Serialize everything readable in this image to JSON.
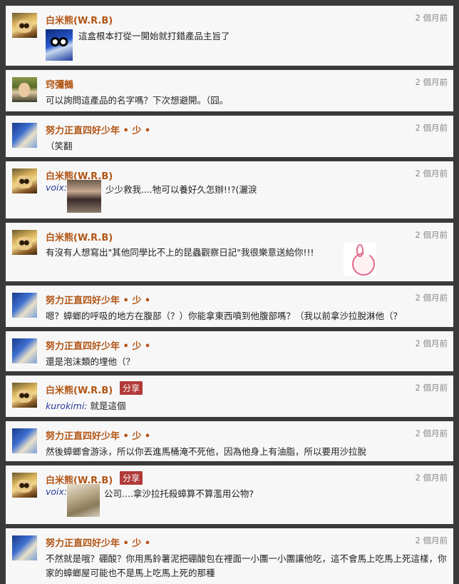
{
  "comments": [
    {
      "author": "白米熊(W.R.B)",
      "time": "2 個月前",
      "text": "這盒根本打從一開始就打錯產品主旨了"
    },
    {
      "author": "窍彌鵺",
      "time": "2 個月前",
      "text": "可以詢問這產品的名字嗎？下次想避開。（囧。"
    },
    {
      "author": "努力正直四好少年 • 少 •",
      "time": "2 個月前",
      "text": "（笑翻"
    },
    {
      "author": "白米熊(W.R.B)",
      "time": "2 個月前",
      "user": "voix:",
      "text": "少少救我....牠可以養好久怎辦!!?(灑淚"
    },
    {
      "author": "白米熊(W.R.B)",
      "time": "2 個月前",
      "text": "有沒有人想寫出\"其他同學比不上的昆蟲觀察日記\"我很樂意送給你!!!"
    },
    {
      "author": "努力正直四好少年 • 少 •",
      "time": "2 個月前",
      "text": "嗯？蟑螂的呼吸的地方在腹部（？）你能拿東西噴到他腹部嗎？（我以前拿沙拉脫淋他（？"
    },
    {
      "author": "努力正直四好少年 • 少 •",
      "time": "2 個月前",
      "text": "還是泡沫類的埋他（？"
    },
    {
      "author": "白米熊(W.R.B)",
      "time": "2 個月前",
      "share": "分享",
      "user": "kurokimi:",
      "text": "就是這個"
    },
    {
      "author": "努力正直四好少年 • 少 •",
      "time": "2 個月前",
      "text": "然後蟑螂會游泳，所以你丟進馬桶淹不死他，因為他身上有油脂，所以要用沙拉脫"
    },
    {
      "author": "白米熊(W.R.B)",
      "time": "2 個月前",
      "share": "分享",
      "user": "voix:",
      "text": "公司....拿沙拉托殺蟑算不算濫用公物?"
    },
    {
      "author": "努力正直四好少年 • 少 •",
      "time": "2 個月前",
      "text": "不然就是哦？硼酸？你用馬鈴薯泥把硼酸包在裡面一小團一小團讓他吃，這不會馬上吃馬上死這樣，你家的蟑螂屋可能也不是馬上吃馬上死的那種"
    }
  ]
}
